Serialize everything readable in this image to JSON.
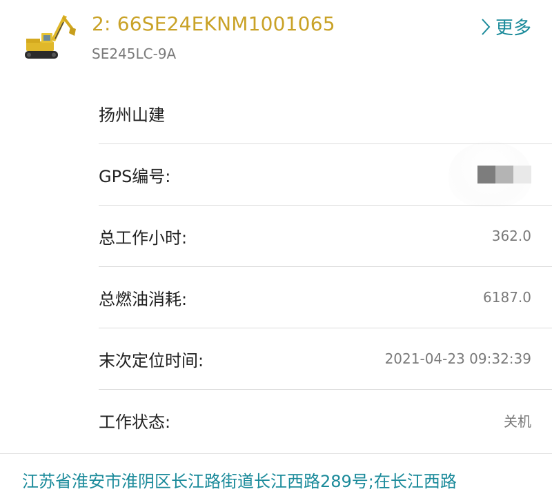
{
  "header": {
    "title": "2: 66SE24EKNM1001065",
    "model": "SE245LC-9A",
    "more_label": "更多",
    "thumb_icon": "excavator-icon",
    "title_color": "#c9a227",
    "accent_color": "#1a8a9a"
  },
  "rows": [
    {
      "label": "扬州山建",
      "value": ""
    },
    {
      "label": "GPS编号:",
      "value": ""
    },
    {
      "label": "总工作小时:",
      "value": "362.0"
    },
    {
      "label": "总燃油消耗:",
      "value": "6187.0"
    },
    {
      "label": "末次定位时间:",
      "value": "2021-04-23 09:32:39"
    },
    {
      "label": "工作状态:",
      "value": "关机"
    }
  ],
  "address": "江苏省淮安市淮阴区长江路街道长江西路289号;在长江西路"
}
